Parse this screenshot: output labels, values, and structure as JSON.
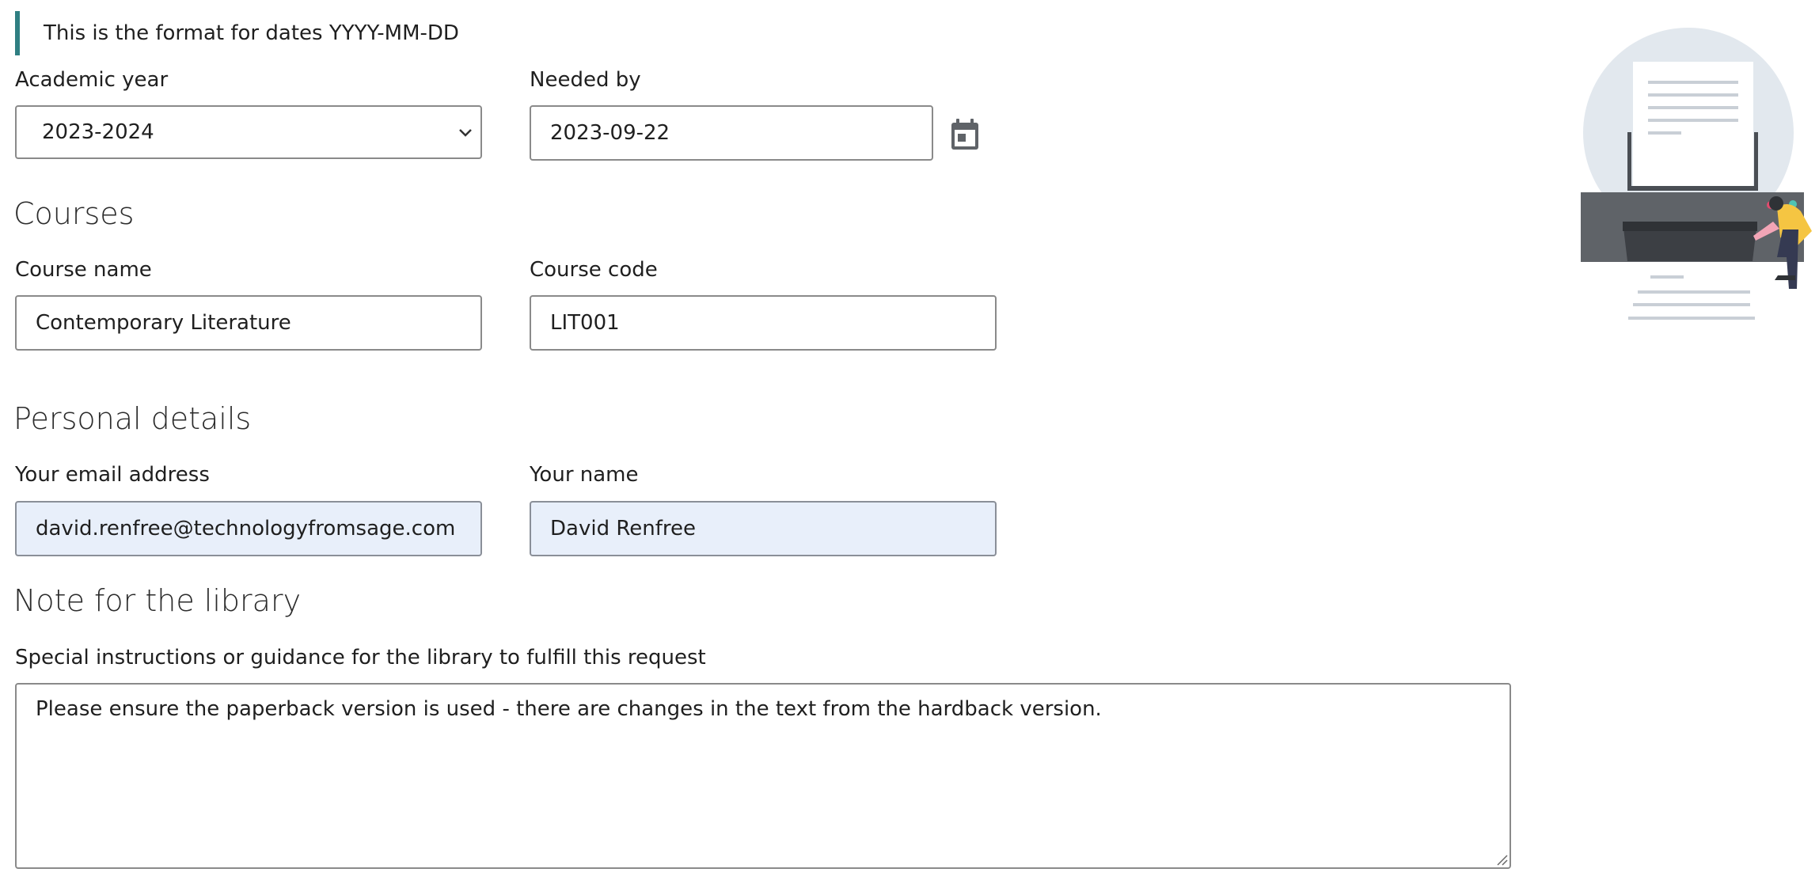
{
  "format_note": "This is the format for dates YYYY-MM-DD",
  "academic_year": {
    "label": "Academic year",
    "value": "2023-2024"
  },
  "needed_by": {
    "label": "Needed by",
    "value": "2023-09-22"
  },
  "courses": {
    "heading": "Courses",
    "course_name_label": "Course name",
    "course_name_value": "Contemporary Literature",
    "course_code_label": "Course code",
    "course_code_value": "LIT001"
  },
  "personal": {
    "heading": "Personal details",
    "email_label": "Your email address",
    "email_value": "david.renfree@technologyfromsage.com",
    "name_label": "Your name",
    "name_value": "David Renfree"
  },
  "note": {
    "heading": "Note for the library",
    "label": "Special instructions or guidance for the library to fulfill this request",
    "value": "Please ensure the paperback version is used - there are changes in the text from the hardback version."
  },
  "icons": {
    "calendar": "calendar-icon",
    "chevron": "chevron-down-icon",
    "illustration": "printer-illustration"
  },
  "colors": {
    "accent_bar": "#2f7f82",
    "autofill_bg": "#e8effa",
    "border": "#8a8a8a"
  }
}
